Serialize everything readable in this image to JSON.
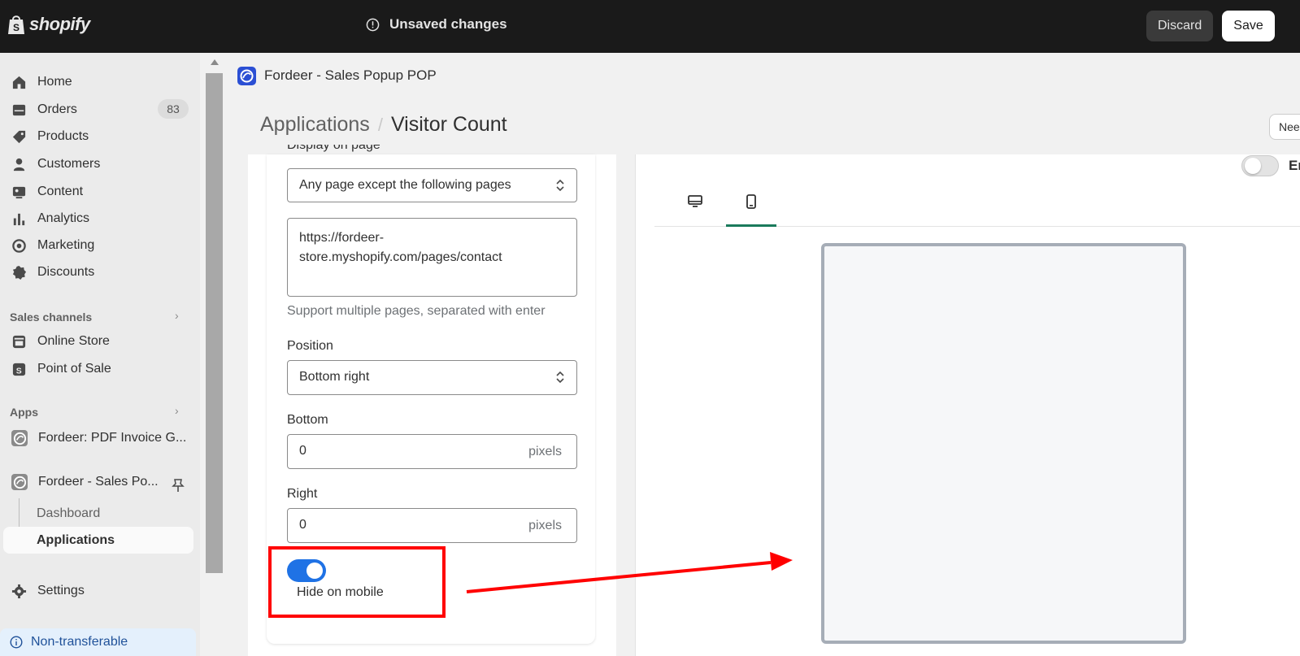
{
  "topbar": {
    "logo_text": "shopify",
    "unsaved_text": "Unsaved changes",
    "discard_label": "Discard",
    "save_label": "Save"
  },
  "sidebar": {
    "items": [
      {
        "label": "Home",
        "icon": "home-icon"
      },
      {
        "label": "Orders",
        "icon": "orders-icon",
        "badge": "83"
      },
      {
        "label": "Products",
        "icon": "tag-icon"
      },
      {
        "label": "Customers",
        "icon": "person-icon"
      },
      {
        "label": "Content",
        "icon": "content-icon"
      },
      {
        "label": "Analytics",
        "icon": "bar-chart-icon"
      },
      {
        "label": "Marketing",
        "icon": "target-icon"
      },
      {
        "label": "Discounts",
        "icon": "discount-icon"
      }
    ],
    "sales_channels_title": "Sales channels",
    "sales_channels": [
      {
        "label": "Online Store",
        "icon": "store-icon"
      },
      {
        "label": "Point of Sale",
        "icon": "pos-icon"
      }
    ],
    "apps_title": "Apps",
    "apps": [
      {
        "label": "Fordeer: PDF Invoice G..."
      },
      {
        "label": "Fordeer - Sales Po..."
      }
    ],
    "app_subitems": [
      "Dashboard",
      "Applications"
    ],
    "settings_label": "Settings",
    "non_transferable": "Non-transferable"
  },
  "app_header": {
    "name": "Fordeer - Sales Popup POP",
    "breadcrumb_parent": "Applications",
    "breadcrumb_current": "Visitor Count",
    "need_button": "Nee"
  },
  "form": {
    "display_on_page_label": "Display on page",
    "display_on_page_value": "Any page except the following pages",
    "pages_textarea": "https://fordeer-\nstore.myshopify.com/pages/contact",
    "pages_help": "Support multiple pages, separated with enter",
    "position_label": "Position",
    "position_value": "Bottom right",
    "bottom_label": "Bottom",
    "bottom_value": "0",
    "bottom_suffix": "pixels",
    "right_label": "Right",
    "right_value": "0",
    "right_suffix": "pixels",
    "hide_on_mobile_label": "Hide on mobile",
    "hide_on_mobile_enabled": true
  },
  "preview": {
    "enable_text": "En",
    "active_tab": "mobile",
    "tabs": [
      "desktop-icon",
      "mobile-icon"
    ]
  },
  "colors": {
    "topbar_bg": "#1a1a1a",
    "toggle_on": "#1f72e5",
    "annotation_red": "#ff0000",
    "tab_active": "#1a7a5c"
  }
}
